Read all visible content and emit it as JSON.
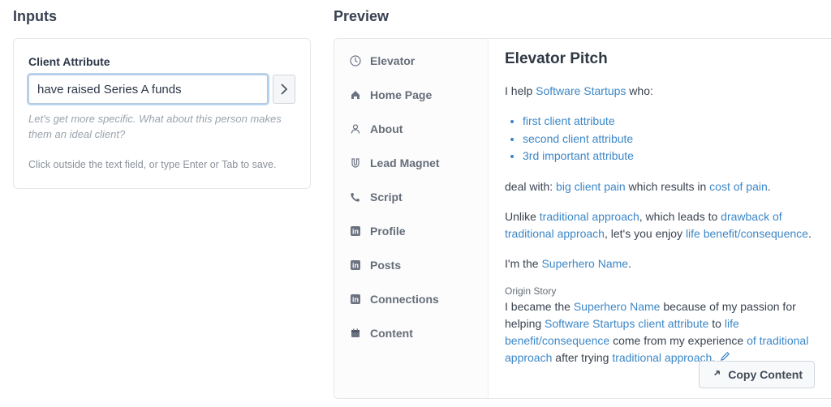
{
  "inputs": {
    "heading": "Inputs",
    "field_label": "Client Attribute",
    "value": "have raised Series A funds",
    "helper": "Let's get more specific. What about this person makes them an ideal client?",
    "hint": "Click outside the text field, or type Enter or Tab to save."
  },
  "preview": {
    "heading": "Preview",
    "nav": [
      {
        "icon": "clock-icon",
        "label": "Elevator"
      },
      {
        "icon": "home-icon",
        "label": "Home Page"
      },
      {
        "icon": "user-outline-icon",
        "label": "About"
      },
      {
        "icon": "magnet-icon",
        "label": "Lead Magnet"
      },
      {
        "icon": "phone-icon",
        "label": "Script"
      },
      {
        "icon": "linkedin-icon",
        "label": "Profile"
      },
      {
        "icon": "linkedin-icon",
        "label": "Posts"
      },
      {
        "icon": "linkedin-icon",
        "label": "Connections"
      },
      {
        "icon": "calendar-icon",
        "label": "Content"
      }
    ],
    "pitch": {
      "title": "Elevator Pitch",
      "line1_pre": "I help ",
      "line1_link": "Software Startups",
      "line1_post": " who:",
      "bullets": [
        "first client attribute",
        "second client attribute",
        "3rd important attribute"
      ],
      "deal_pre": "deal with: ",
      "deal_link1": "big client pain",
      "deal_mid": " which results in ",
      "deal_link2": "cost of pain",
      "deal_post": ".",
      "unlike_pre": "Unlike ",
      "unlike_link1": "traditional approach",
      "unlike_mid1": ", which leads to ",
      "unlike_link2": "drawback of traditional approach",
      "unlike_mid2": ", let's you enjoy ",
      "unlike_link3": "life benefit/consequence",
      "unlike_post": ".",
      "im_pre": "I'm the ",
      "im_link": "Superhero Name",
      "im_post": ".",
      "origin_label": "Origin Story",
      "origin_t1": "I became the ",
      "origin_l1": "Superhero Name",
      "origin_t2": " because of my passion for helping ",
      "origin_l2": "Software Startups",
      "origin_t3": " ",
      "origin_l3": "client attribute",
      "origin_t4": " to ",
      "origin_l4": "life benefit/consequence",
      "origin_t5": " come from my experience ",
      "origin_l5": "of traditional approach",
      "origin_t6": " after trying ",
      "origin_l6": "traditional approach",
      "origin_t7": "."
    },
    "copy_label": "Copy Content"
  }
}
